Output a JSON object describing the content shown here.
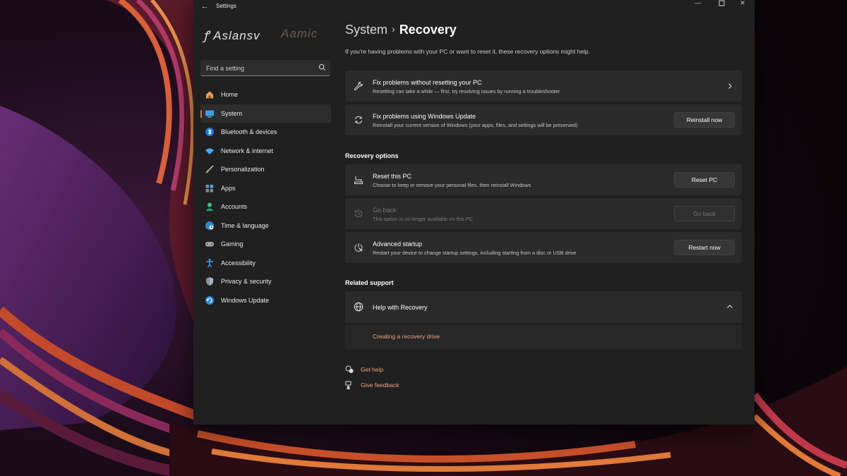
{
  "window": {
    "title": "Settings"
  },
  "user": {
    "name": "ꝭ Aslansv",
    "extra": "Aamic"
  },
  "search": {
    "placeholder": "Find a setting"
  },
  "sidebar": {
    "items": [
      {
        "label": "Home",
        "icon": "home-icon"
      },
      {
        "label": "System",
        "icon": "system-icon",
        "active": true
      },
      {
        "label": "Bluetooth & devices",
        "icon": "bluetooth-icon"
      },
      {
        "label": "Network & internet",
        "icon": "wifi-icon"
      },
      {
        "label": "Personalization",
        "icon": "brush-icon"
      },
      {
        "label": "Apps",
        "icon": "apps-icon"
      },
      {
        "label": "Accounts",
        "icon": "accounts-icon"
      },
      {
        "label": "Time & language",
        "icon": "globe-clock-icon"
      },
      {
        "label": "Gaming",
        "icon": "controller-icon"
      },
      {
        "label": "Accessibility",
        "icon": "accessibility-icon"
      },
      {
        "label": "Privacy & security",
        "icon": "shield-icon"
      },
      {
        "label": "Windows Update",
        "icon": "update-icon"
      }
    ]
  },
  "header": {
    "parent": "System",
    "separator": "›",
    "current": "Recovery",
    "intro": "If you're having problems with your PC or want to reset it, these recovery options might help."
  },
  "top_cards": [
    {
      "title": "Fix problems without resetting your PC",
      "desc": "Resetting can take a while — first, try resolving issues by running a troubleshooter"
    },
    {
      "title": "Fix problems using Windows Update",
      "desc": "Reinstall your current version of Windows (your apps, files, and settings will be preserved)",
      "button": "Reinstall now"
    }
  ],
  "recovery_options": {
    "heading": "Recovery options",
    "items": [
      {
        "title": "Reset this PC",
        "desc": "Choose to keep or remove your personal files, then reinstall Windows",
        "button": "Reset PC"
      },
      {
        "title": "Go back",
        "desc": "This option is no longer available on this PC",
        "button": "Go back",
        "disabled": true
      },
      {
        "title": "Advanced startup",
        "desc": "Restart your device to change startup settings, including starting from a disc or USB drive",
        "button": "Restart now"
      }
    ]
  },
  "related_support": {
    "heading": "Related support",
    "help_title": "Help with Recovery",
    "help_link": "Creating a recovery drive"
  },
  "footer_links": {
    "get_help": "Get help",
    "give_feedback": "Give feedback"
  },
  "colors": {
    "accent": "#e56b52",
    "link": "#f0a184",
    "window_bg": "#202020",
    "card_bg": "#2b2b2b"
  }
}
